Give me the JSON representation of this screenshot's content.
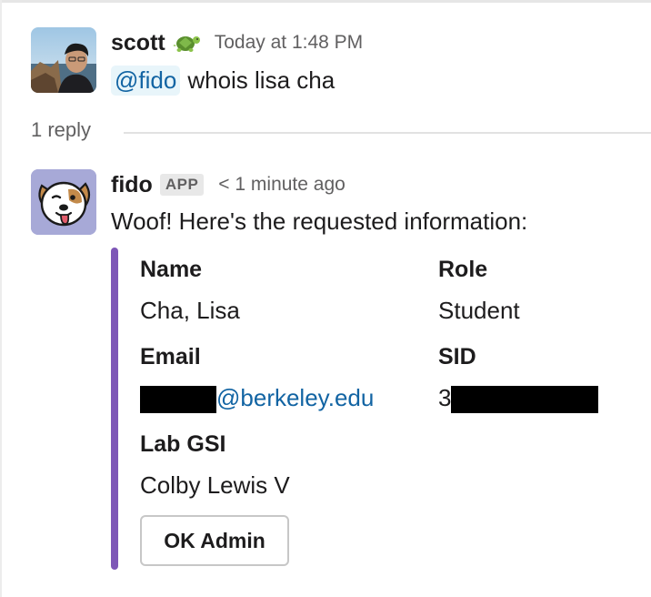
{
  "colors": {
    "accent_bar": "#7e57b7",
    "link": "#1264a3",
    "mention_bg": "#e8f5fa",
    "muted": "#616061"
  },
  "message1": {
    "username": "scott",
    "status_emoji": "turtle-emoji",
    "timestamp": "Today at 1:48 PM",
    "mention": "@fido",
    "text": "whois lisa cha"
  },
  "thread": {
    "replies_label": "1 reply"
  },
  "message2": {
    "username": "fido",
    "badge": "APP",
    "timestamp": "< 1 minute ago",
    "text": "Woof! Here's the requested information:",
    "fields": {
      "name_label": "Name",
      "name_value": "Cha, Lisa",
      "role_label": "Role",
      "role_value": "Student",
      "email_label": "Email",
      "email_domain": "@berkeley.edu",
      "sid_label": "SID",
      "sid_prefix": "3",
      "gsi_label": "Lab GSI",
      "gsi_value": "Colby Lewis V"
    },
    "button_label": "OK Admin"
  }
}
